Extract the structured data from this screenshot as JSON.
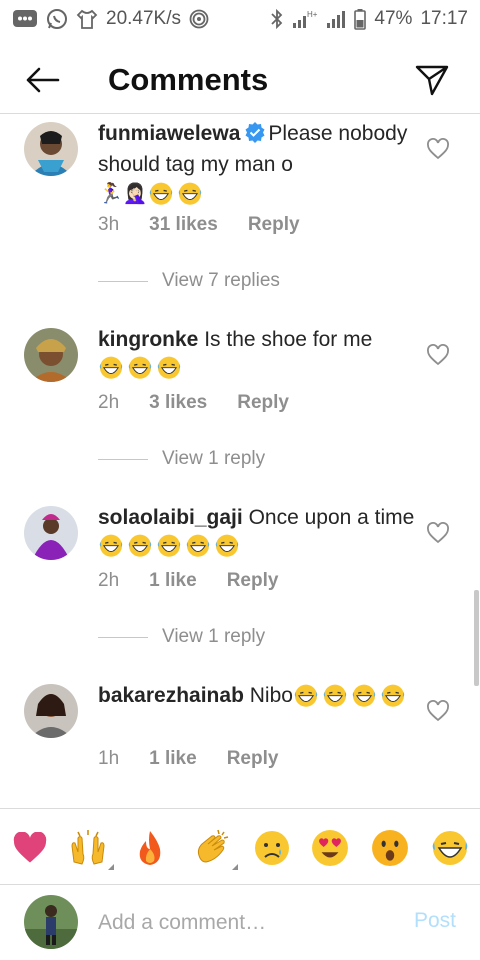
{
  "status_bar": {
    "speed": "20.47K/s",
    "network": "H+",
    "battery": "47%",
    "time": "17:17"
  },
  "header": {
    "title": "Comments",
    "back_icon": "arrow-left-icon",
    "send_icon": "paper-plane-icon"
  },
  "comments": [
    {
      "username": "funmiawelewa",
      "verified": true,
      "text": "Please nobody should tag my man o",
      "emoji_line": "🏃‍♀️🤦🏻‍♀️",
      "laughs": 2,
      "time": "3h",
      "likes": "31 likes",
      "reply": "Reply",
      "view_replies": "View 7 replies"
    },
    {
      "username": "kingronke",
      "verified": false,
      "text": "Is the shoe for me",
      "laughs": 3,
      "time": "2h",
      "likes": "3 likes",
      "reply": "Reply",
      "view_replies": "View 1 reply"
    },
    {
      "username": "solaolaibi_gaji",
      "verified": false,
      "text": "Once upon a time",
      "laughs": 5,
      "time": "2h",
      "likes": "1 like",
      "reply": "Reply",
      "view_replies": "View 1 reply"
    },
    {
      "username": "bakarezhainab",
      "verified": false,
      "text": "Nibo",
      "laughs": 4,
      "time": "1h",
      "likes": "1 like",
      "reply": "Reply"
    }
  ],
  "emoji_bar": [
    "heart-emoji",
    "raised-hands-emoji",
    "fire-emoji",
    "clapping-hands-emoji",
    "crying-face-emoji",
    "heart-eyes-emoji",
    "surprised-face-emoji",
    "laughing-face-emoji"
  ],
  "composer": {
    "placeholder": "Add a comment…",
    "post": "Post"
  },
  "colors": {
    "accent": "#0095f6",
    "post_disabled": "#b2dffc",
    "verified": "#3897f0",
    "secondary_text": "#8e8e8e"
  }
}
